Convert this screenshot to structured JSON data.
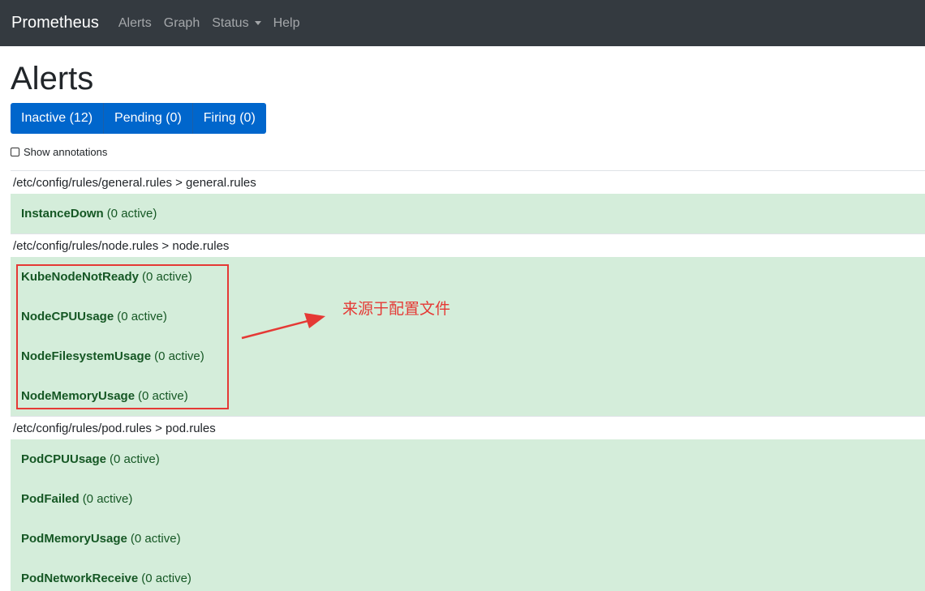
{
  "navbar": {
    "brand": "Prometheus",
    "items": [
      {
        "label": "Alerts"
      },
      {
        "label": "Graph"
      },
      {
        "label": "Status"
      },
      {
        "label": "Help"
      }
    ]
  },
  "page": {
    "title": "Alerts"
  },
  "tabs": [
    {
      "label": "Inactive (12)"
    },
    {
      "label": "Pending (0)"
    },
    {
      "label": "Firing (0)"
    }
  ],
  "show_annotations": {
    "label": "Show annotations",
    "checked": false
  },
  "groups": [
    {
      "header": "/etc/config/rules/general.rules > general.rules",
      "rules": [
        {
          "name": "InstanceDown",
          "count": "(0 active)"
        }
      ]
    },
    {
      "header": "/etc/config/rules/node.rules > node.rules",
      "rules": [
        {
          "name": "KubeNodeNotReady",
          "count": "(0 active)"
        },
        {
          "name": "NodeCPUUsage",
          "count": "(0 active)"
        },
        {
          "name": "NodeFilesystemUsage",
          "count": "(0 active)"
        },
        {
          "name": "NodeMemoryUsage",
          "count": "(0 active)"
        }
      ]
    },
    {
      "header": "/etc/config/rules/pod.rules > pod.rules",
      "rules": [
        {
          "name": "PodCPUUsage",
          "count": "(0 active)"
        },
        {
          "name": "PodFailed",
          "count": "(0 active)"
        },
        {
          "name": "PodMemoryUsage",
          "count": "(0 active)"
        },
        {
          "name": "PodNetworkReceive",
          "count": "(0 active)"
        }
      ]
    }
  ],
  "annotation": {
    "text": "来源于配置文件",
    "color": "#e53935"
  },
  "colors": {
    "navbar_bg": "#343a40",
    "tab_bg": "#0066cc",
    "rule_bg": "#d4edda",
    "rule_text": "#155724"
  }
}
